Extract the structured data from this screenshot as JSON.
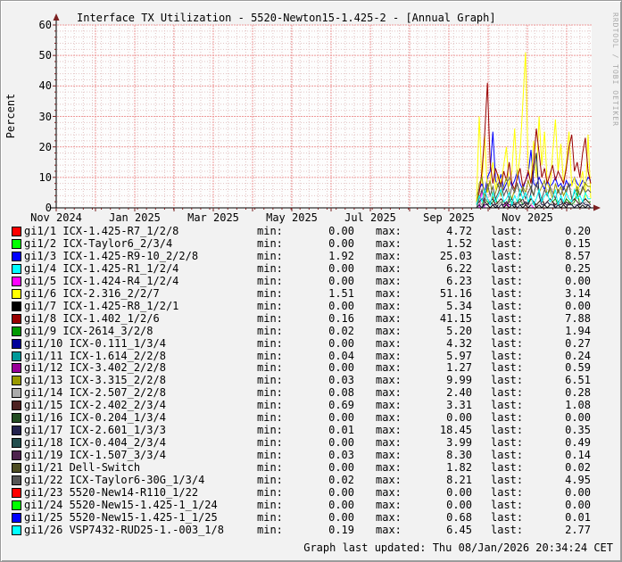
{
  "header": {
    "title": "Interface TX Utilization - 5520-Newton15-1.425-2 - [Annual Graph]"
  },
  "watermark": "RRDTOOL / TOBI OETIKER",
  "footer": {
    "last_updated": "Graph last updated: Thu 08/Jan/2026 20:34:24 CET"
  },
  "chart_data": {
    "type": "line",
    "title": "Interface TX Utilization - 5520-Newton15-1.425-2 - [Annual Graph]",
    "ylabel": "Percent",
    "ylim": [
      0,
      60
    ],
    "y_ticks": [
      0,
      10,
      20,
      30,
      40,
      50,
      60
    ],
    "x_tick_labels": [
      "Nov 2024",
      "Jan 2025",
      "Mar 2025",
      "May 2025",
      "Jul 2025",
      "Sep 2025",
      "Nov 2025"
    ],
    "x_axis_span": [
      "Nov 2024",
      "Jan 2026"
    ],
    "grid": {
      "minor_color": "#e2c4c4",
      "major_color": "#ee9999",
      "axis_color": "#000000",
      "arrow_color": "#7b2020",
      "canvas": "#fdfdfd"
    },
    "legend_position": "below",
    "data_window": {
      "from": "late Sep 2025",
      "to": "Jan 2026",
      "note": "lines are flat/absent before late Sep 2025; values in percent, sampled ~every 2 days"
    },
    "series": [
      {
        "port": "gi1/3",
        "color": "#0000FF",
        "values": [
          4,
          6,
          8,
          5,
          10,
          12,
          25,
          9,
          7,
          11,
          6,
          8,
          10,
          7,
          9,
          12,
          8,
          6,
          9,
          11,
          19,
          8,
          7,
          10,
          8,
          6,
          9,
          7,
          8,
          10,
          7,
          8,
          6,
          9,
          7,
          8,
          10,
          8,
          7,
          9,
          8,
          10,
          9
        ]
      },
      {
        "port": "gi1/5",
        "color": "#FF00FF",
        "values": [
          0,
          0,
          6,
          0,
          0,
          0,
          0,
          0,
          0,
          0,
          0,
          2,
          0,
          0,
          0,
          0,
          0,
          0,
          0,
          0,
          1,
          0,
          0,
          0,
          0,
          0,
          0,
          0,
          0,
          0,
          0,
          0,
          0,
          0,
          0,
          0,
          0,
          0,
          0,
          0,
          0,
          0,
          0
        ]
      },
      {
        "port": "gi1/6",
        "color": "#FFFF00",
        "values": [
          2,
          30,
          8,
          24,
          5,
          9,
          15,
          6,
          11,
          8,
          14,
          20,
          7,
          12,
          26,
          9,
          18,
          34,
          51,
          13,
          8,
          22,
          10,
          30,
          14,
          25,
          8,
          6,
          18,
          29,
          12,
          21,
          8,
          15,
          25,
          7,
          10,
          5,
          8,
          12,
          3,
          24,
          3
        ]
      },
      {
        "port": "gi1/7",
        "color": "#000000",
        "values": [
          0,
          1,
          0,
          2,
          1,
          0,
          1,
          0,
          1,
          2,
          0,
          1,
          0,
          1,
          0,
          2,
          1,
          0,
          1,
          0,
          1,
          2,
          0,
          1,
          0,
          1,
          0,
          1,
          2,
          0,
          1,
          0,
          1,
          0,
          2,
          1,
          0,
          1,
          0,
          1,
          0,
          1,
          0
        ]
      },
      {
        "port": "gi1/8",
        "color": "#990000",
        "values": [
          1,
          5,
          12,
          24,
          41,
          15,
          8,
          13,
          10,
          7,
          12,
          9,
          15,
          8,
          6,
          10,
          13,
          7,
          9,
          12,
          8,
          15,
          26,
          18,
          10,
          13,
          8,
          11,
          14,
          9,
          12,
          10,
          8,
          13,
          20,
          24,
          12,
          15,
          10,
          18,
          23,
          12,
          8
        ]
      },
      {
        "port": "gi1/9",
        "color": "#009900",
        "values": [
          1,
          2,
          1,
          3,
          2,
          1,
          2,
          3,
          1,
          2,
          2,
          1,
          3,
          2,
          1,
          2,
          3,
          1,
          2,
          1,
          3,
          2,
          1,
          2,
          3,
          1,
          2,
          1,
          2,
          3,
          1,
          2,
          1,
          3,
          2,
          1,
          2,
          5,
          1,
          2,
          3,
          2,
          2
        ]
      },
      {
        "port": "gi1/13",
        "color": "#999900",
        "values": [
          1,
          8,
          10,
          4,
          6,
          9,
          3,
          5,
          8,
          4,
          7,
          10,
          5,
          3,
          6,
          8,
          4,
          7,
          5,
          9,
          6,
          4,
          8,
          5,
          7,
          9,
          4,
          6,
          3,
          8,
          5,
          7,
          4,
          6,
          8,
          3,
          5,
          7,
          4,
          6,
          8,
          7,
          7
        ]
      },
      {
        "port": "gi1/14",
        "color": "#ABABAB",
        "values": [
          1,
          2,
          1,
          2,
          3,
          2,
          1,
          2,
          1,
          2,
          1,
          2,
          2,
          1,
          2,
          1,
          2,
          2,
          1,
          2,
          1,
          2,
          1,
          1,
          2,
          1,
          2,
          1,
          2,
          1,
          1,
          2,
          1,
          2,
          1,
          2,
          1,
          1,
          2,
          1,
          2,
          1,
          1
        ]
      },
      {
        "port": "gi1/15",
        "color": "#4D2222",
        "values": [
          1,
          2,
          3,
          2,
          1,
          2,
          3,
          1,
          2,
          3,
          2,
          1,
          2,
          3,
          1,
          2,
          2,
          3,
          1,
          2,
          3,
          2,
          1,
          2,
          3,
          1,
          2,
          3,
          2,
          1,
          2,
          3,
          1,
          2,
          1,
          2,
          3,
          2,
          1,
          2,
          3,
          2,
          1
        ]
      },
      {
        "port": "gi1/17",
        "color": "#22224D",
        "values": [
          0,
          1,
          0,
          1,
          1,
          2,
          1,
          1,
          0,
          1,
          1,
          2,
          1,
          1,
          1,
          0,
          1,
          1,
          2,
          1,
          5,
          12,
          18,
          4,
          1,
          1,
          2,
          1,
          1,
          0,
          1,
          1,
          2,
          1,
          1,
          1,
          0,
          1,
          1,
          2,
          1,
          1,
          0
        ]
      },
      {
        "port": "gi1/22",
        "color": "#555555",
        "values": [
          0,
          3,
          6,
          2,
          8,
          4,
          7,
          3,
          5,
          8,
          4,
          6,
          3,
          7,
          5,
          8,
          4,
          6,
          3,
          5,
          7,
          4,
          8,
          5,
          3,
          6,
          4,
          7,
          5,
          3,
          6,
          4,
          7,
          5,
          8,
          3,
          5,
          6,
          4,
          7,
          5,
          6,
          5
        ]
      },
      {
        "port": "gi1/26",
        "color": "#00FFFF",
        "values": [
          1,
          4,
          2,
          6,
          3,
          1,
          5,
          2,
          4,
          6,
          2,
          3,
          5,
          1,
          4,
          2,
          6,
          3,
          5,
          2,
          4,
          1,
          3,
          6,
          2,
          4,
          5,
          2,
          3,
          6,
          1,
          4,
          2,
          5,
          3,
          2,
          6,
          3,
          4,
          2,
          5,
          3,
          3
        ]
      }
    ]
  },
  "legend": {
    "labels": {
      "min": "min:",
      "max": "max:",
      "last": "last:"
    },
    "rows": [
      {
        "port": "gi1/1",
        "name": "ICX-1.425-R7_1/2/8",
        "color": "#FF0000",
        "min": "0.00",
        "max": "4.72",
        "last": "0.20"
      },
      {
        "port": "gi1/2",
        "name": "ICX-Taylor6_2/3/4",
        "color": "#00FF00",
        "min": "0.00",
        "max": "1.52",
        "last": "0.15"
      },
      {
        "port": "gi1/3",
        "name": "ICX-1.425-R9-10_2/2/8",
        "color": "#0000FF",
        "min": "1.92",
        "max": "25.03",
        "last": "8.57"
      },
      {
        "port": "gi1/4",
        "name": "ICX-1.425-R1_1/2/4",
        "color": "#00FFFF",
        "min": "0.00",
        "max": "6.22",
        "last": "0.25"
      },
      {
        "port": "gi1/5",
        "name": "ICX-1.424-R4_1/2/4",
        "color": "#FF00FF",
        "min": "0.00",
        "max": "6.23",
        "last": "0.00"
      },
      {
        "port": "gi1/6",
        "name": "ICX-2.316_2/2/7",
        "color": "#FFFF00",
        "min": "1.51",
        "max": "51.16",
        "last": "3.14"
      },
      {
        "port": "gi1/7",
        "name": "ICX-1.425-R8_1/2/1",
        "color": "#000000",
        "min": "0.00",
        "max": "5.34",
        "last": "0.00"
      },
      {
        "port": "gi1/8",
        "name": "ICX-1.402_1/2/6",
        "color": "#990000",
        "min": "0.16",
        "max": "41.15",
        "last": "7.88"
      },
      {
        "port": "gi1/9",
        "name": "ICX-2614_3/2/8",
        "color": "#009900",
        "min": "0.02",
        "max": "5.20",
        "last": "1.94"
      },
      {
        "port": "gi1/10",
        "name": "ICX-0.111_1/3/4",
        "color": "#000099",
        "min": "0.00",
        "max": "4.32",
        "last": "0.27"
      },
      {
        "port": "gi1/11",
        "name": "ICX-1.614_2/2/8",
        "color": "#009999",
        "min": "0.04",
        "max": "5.97",
        "last": "0.24"
      },
      {
        "port": "gi1/12",
        "name": "ICX-3.402_2/2/8",
        "color": "#990099",
        "min": "0.00",
        "max": "1.27",
        "last": "0.59"
      },
      {
        "port": "gi1/13",
        "name": "ICX-3.315_2/2/8",
        "color": "#999900",
        "min": "0.03",
        "max": "9.99",
        "last": "6.51"
      },
      {
        "port": "gi1/14",
        "name": "ICX-2.507_2/2/8",
        "color": "#ABABAB",
        "min": "0.08",
        "max": "2.40",
        "last": "0.28"
      },
      {
        "port": "gi1/15",
        "name": "ICX-2.402_2/3/4",
        "color": "#4D2222",
        "min": "0.69",
        "max": "3.31",
        "last": "1.08"
      },
      {
        "port": "gi1/16",
        "name": "ICX-0.204_1/3/4",
        "color": "#224D22",
        "min": "0.00",
        "max": "0.00",
        "last": "0.00"
      },
      {
        "port": "gi1/17",
        "name": "ICX-2.601_1/3/3",
        "color": "#22224D",
        "min": "0.01",
        "max": "18.45",
        "last": "0.35"
      },
      {
        "port": "gi1/18",
        "name": "ICX-0.404_2/3/4",
        "color": "#224D4D",
        "min": "0.00",
        "max": "3.99",
        "last": "0.49"
      },
      {
        "port": "gi1/19",
        "name": "ICX-1.507_3/3/4",
        "color": "#4D224D",
        "min": "0.03",
        "max": "8.30",
        "last": "0.14"
      },
      {
        "port": "gi1/21",
        "name": "Dell-Switch",
        "color": "#4D4D22",
        "min": "0.00",
        "max": "1.82",
        "last": "0.02"
      },
      {
        "port": "gi1/22",
        "name": "ICX-Taylor6-30G_1/3/4",
        "color": "#555555",
        "min": "0.02",
        "max": "8.21",
        "last": "4.95"
      },
      {
        "port": "gi1/23",
        "name": "5520-New14-R110_1/22",
        "color": "#FF0000",
        "min": "0.00",
        "max": "0.00",
        "last": "0.00"
      },
      {
        "port": "gi1/24",
        "name": "5520-New15-1.425-1_1/24",
        "color": "#00FF00",
        "min": "0.00",
        "max": "0.00",
        "last": "0.00"
      },
      {
        "port": "gi1/25",
        "name": "5520-New15-1.425-1_1/25",
        "color": "#0000FF",
        "min": "0.00",
        "max": "0.68",
        "last": "0.01"
      },
      {
        "port": "gi1/26",
        "name": "VSP7432-RUD25-1.-003_1/8",
        "color": "#00FFFF",
        "min": "0.19",
        "max": "6.45",
        "last": "2.77"
      }
    ]
  }
}
